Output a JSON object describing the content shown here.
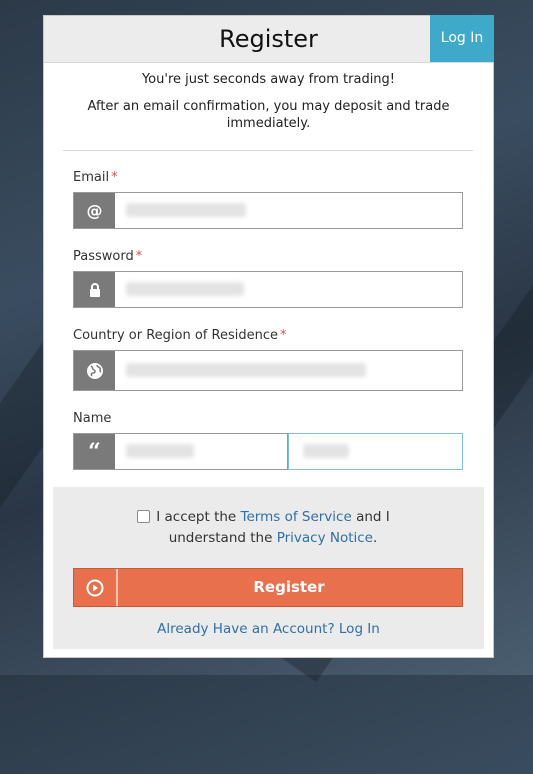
{
  "header": {
    "title": "Register",
    "login_tab": "Log In"
  },
  "intro": {
    "line1": "You're just seconds away from trading!",
    "line2": "After an email confirmation, you may deposit and trade immediately."
  },
  "fields": {
    "email": {
      "label": "Email",
      "required": "*",
      "icon": "at-icon"
    },
    "password": {
      "label": "Password",
      "required": "*",
      "icon": "lock-icon"
    },
    "country": {
      "label": "Country or Region of Residence",
      "required": "*",
      "icon": "globe-icon"
    },
    "name": {
      "label": "Name",
      "icon": "quote-icon"
    }
  },
  "terms": {
    "prefix": "I accept the ",
    "tos_link": "Terms of Service",
    "middle": " and I understand the ",
    "privacy_link": "Privacy Notice",
    "suffix": "."
  },
  "register_button": {
    "label": "Register",
    "icon": "play-circle-icon"
  },
  "already_link": "Already Have an Account? Log In",
  "colors": {
    "accent": "#e8704d",
    "login_tab": "#3fa9c9",
    "link": "#2f6fa8",
    "required": "#d9534f"
  }
}
